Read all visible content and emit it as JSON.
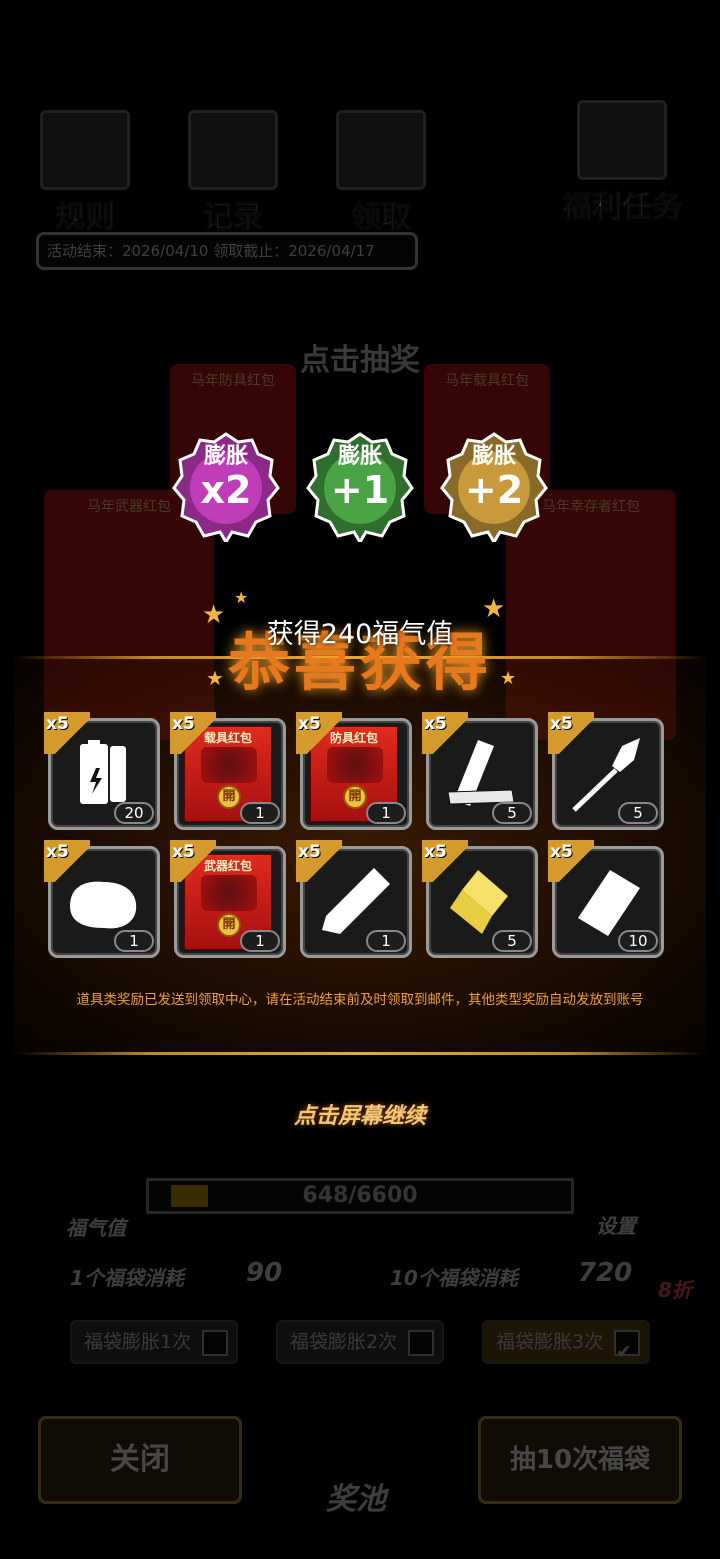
{
  "top_menu": {
    "rules_label": "规则",
    "records_label": "记录",
    "claim_label": "领取",
    "tasks_label": "福利任务"
  },
  "activity_dates": "活动结束：2026/04/10  领取截止：2026/04/17",
  "draw_title": "点击抽奖",
  "packs": {
    "top_left": "马年防具红包",
    "top_right": "马年载具红包",
    "weapon": "马年武器红包",
    "survivor": "马年幸存者红包"
  },
  "badges": [
    {
      "top": "膨胀",
      "value": "x2",
      "color": "#b03aa8"
    },
    {
      "top": "膨胀",
      "value": "+1",
      "color": "#3f9a3a"
    },
    {
      "top": "膨胀",
      "value": "+2",
      "color": "#c49a3a"
    }
  ],
  "gain_text": "获得240福气值",
  "congrats_text": "恭喜获得",
  "items": [
    {
      "mult": "x5",
      "count": "20",
      "icon": "battery-icon"
    },
    {
      "mult": "x5",
      "count": "1",
      "icon": "vehicle-redpack-icon",
      "pack_title": "载具红包"
    },
    {
      "mult": "x5",
      "count": "1",
      "icon": "armor-redpack-icon",
      "pack_title": "防具红包"
    },
    {
      "mult": "x5",
      "count": "5",
      "icon": "plank-icon"
    },
    {
      "mult": "x5",
      "count": "5",
      "icon": "spear-icon"
    },
    {
      "mult": "x5",
      "count": "1",
      "icon": "ore-icon"
    },
    {
      "mult": "x5",
      "count": "1",
      "icon": "weapon-redpack-icon",
      "pack_title": "武器红包"
    },
    {
      "mult": "x5",
      "count": "1",
      "icon": "tube-icon"
    },
    {
      "mult": "x5",
      "count": "5",
      "icon": "gold-cylinder-icon"
    },
    {
      "mult": "x5",
      "count": "10",
      "icon": "bag-icon"
    }
  ],
  "seal_char": "開",
  "notice": "道具类奖励已发送到领取中心，请在活动结束前及时领取到邮件，其他类型奖励自动发放到账号",
  "continue_text": "点击屏幕继续",
  "luck": {
    "label": "福气值",
    "progress_text": "648/6600",
    "progress": 0.098
  },
  "settings_label": "设置",
  "cost": {
    "one_label": "1个福袋消耗",
    "one_value": "90",
    "ten_label": "10个福袋消耗",
    "ten_value": "720",
    "discount": "8折",
    "currency_label": "福气值"
  },
  "options": [
    {
      "label": "福袋膨胀1次",
      "checked": false
    },
    {
      "label": "福袋膨胀2次",
      "checked": false
    },
    {
      "label": "福袋膨胀3次",
      "checked": true
    }
  ],
  "buttons": {
    "close": "关闭",
    "pool": "奖池",
    "draw10": "抽10次福袋"
  }
}
